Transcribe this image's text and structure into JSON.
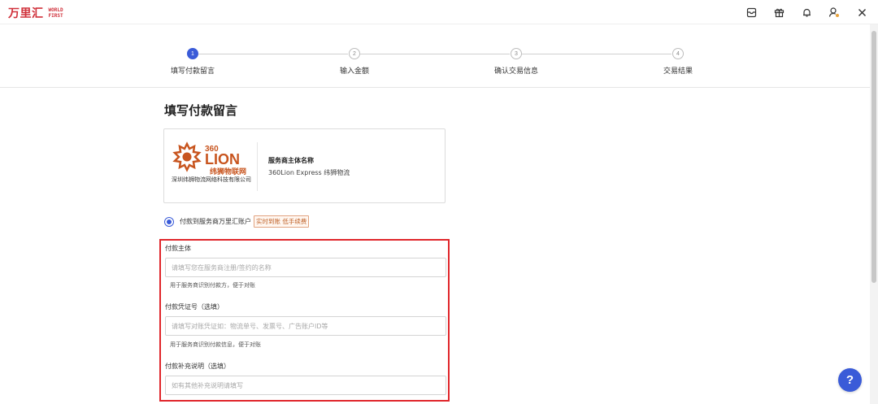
{
  "app": {
    "logo_cn": "万里汇",
    "logo_en_line1": "WORLD",
    "logo_en_line2": "FIRST",
    "brand_color": "#d0313b"
  },
  "topbar_icons": [
    "inbox-icon",
    "gift-icon",
    "bell-icon",
    "user-icon",
    "close-icon"
  ],
  "stepper": {
    "steps": [
      {
        "num": "1",
        "label": "填写付款留言",
        "active": true
      },
      {
        "num": "2",
        "label": "输入金额",
        "active": false
      },
      {
        "num": "3",
        "label": "确认交易信息",
        "active": false
      },
      {
        "num": "4",
        "label": "交易结果",
        "active": false
      }
    ],
    "active_color": "#3a5bd8"
  },
  "page_title": "填写付款留言",
  "provider": {
    "logo_text_top": "360",
    "logo_text_mid": "LION",
    "logo_text_cn": "纬狮物联网",
    "company": "深圳纬狮物流网络科技有限公司",
    "label": "服务商主体名称",
    "name": "360Lion Express 纬狮物流"
  },
  "payment_option": {
    "label": "付款到服务商万里汇账户",
    "tag": "实时到账 低手续费",
    "selected": true
  },
  "form": {
    "payer": {
      "label": "付款主体",
      "placeholder": "请填写您在服务商注册/签约的名称",
      "help": "用于服务商识别付款方，便于对账"
    },
    "voucher": {
      "label": "付款凭证号（选填）",
      "placeholder": "请填写对账凭证如：物流单号、发票号、广告账户ID等",
      "help": "用于服务商识别付款信息，便于对账"
    },
    "remark": {
      "label": "付款补充说明（选填）",
      "placeholder": "如有其他补充说明请填写"
    },
    "highlight_color": "#e0262b"
  },
  "help_button": "?"
}
